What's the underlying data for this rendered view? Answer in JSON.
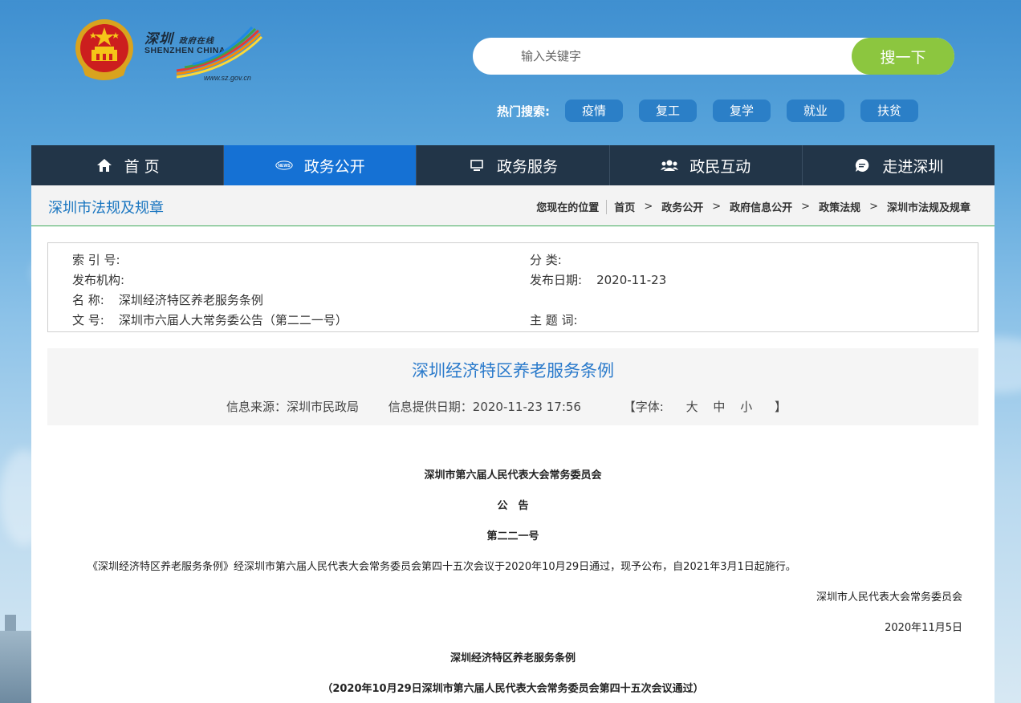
{
  "header": {
    "brand_cn": "深圳",
    "brand_cn_small": "政府在线",
    "brand_en": "SHENZHEN CHINA",
    "brand_url": "www.sz.gov.cn"
  },
  "search": {
    "placeholder": "输入关键字",
    "button_label": "搜一下"
  },
  "hot_search": {
    "label": "热门搜索:",
    "tags": [
      "疫情",
      "复工",
      "复学",
      "就业",
      "扶贫"
    ]
  },
  "nav": {
    "items": [
      {
        "label": "首 页",
        "icon": "home-icon"
      },
      {
        "label": "政务公开",
        "icon": "news-icon",
        "active": true
      },
      {
        "label": "政务服务",
        "icon": "monitor-icon"
      },
      {
        "label": "政民互动",
        "icon": "users-icon"
      },
      {
        "label": "走进深圳",
        "icon": "chat-icon"
      }
    ]
  },
  "breadcrumb": {
    "section_title": "深圳市法规及规章",
    "location_label": "您现在的位置",
    "items": [
      "首页",
      "政务公开",
      "政府信息公开",
      "政策法规",
      "深圳市法规及规章"
    ]
  },
  "meta": {
    "index_label": "索 引 号:",
    "index_value": "",
    "category_label": "分 类:",
    "category_value": "",
    "publisher_label": "发布机构:",
    "publisher_value": "",
    "date_label": "发布日期:",
    "date_value": "2020-11-23",
    "name_label": "名 称:",
    "name_value": "深圳经济特区养老服务条例",
    "docno_label": "文 号:",
    "docno_value": "深圳市六届人大常务委公告（第二二一号）",
    "keywords_label": "主 题 词:",
    "keywords_value": ""
  },
  "doc": {
    "title": "深圳经济特区养老服务条例",
    "source": "信息来源：深圳市民政局",
    "provided_date": "信息提供日期：2020-11-23 17:56",
    "font_label": "【字体:",
    "font_large": "大",
    "font_medium": "中",
    "font_small": "小",
    "font_close": "】"
  },
  "content": {
    "p1": "深圳市第六届人民代表大会常务委员会",
    "p2": "公　告",
    "p3": "第二二一号",
    "p4": "《深圳经济特区养老服务条例》经深圳市第六届人民代表大会常务委员会第四十五次会议于2020年10月29日通过，现予公布，自2021年3月1日起施行。",
    "p5": "深圳市人民代表大会常务委员会",
    "p6": "2020年11月5日",
    "p7": "深圳经济特区养老服务条例",
    "p8": "（2020年10月29日深圳市第六届人民代表大会常务委员会第四十五次会议通过）"
  },
  "colors": {
    "nav_bg": "#223548",
    "nav_active": "#1571d4",
    "search_button": "#8cc63f",
    "hot_tag": "#2b7fc7",
    "title_blue": "#2a7acb"
  }
}
